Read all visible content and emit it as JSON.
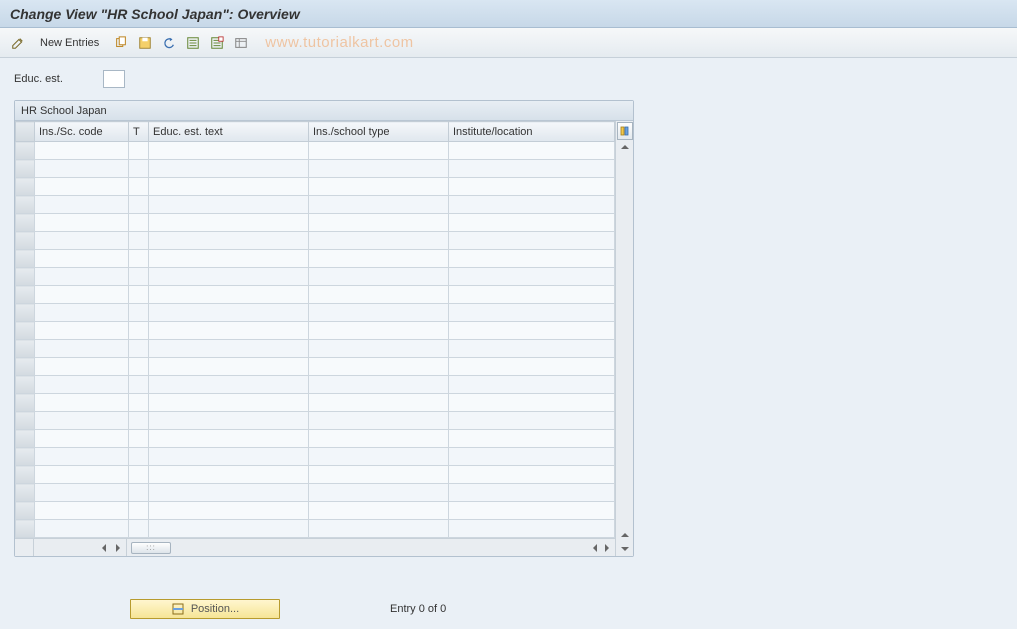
{
  "title": "Change View \"HR School Japan\": Overview",
  "toolbar": {
    "new_entries_label": "New Entries"
  },
  "watermark": "www.tutorialkart.com",
  "field": {
    "label": "Educ. est.",
    "value": ""
  },
  "table": {
    "group_title": "HR School Japan",
    "columns": [
      "Ins./Sc. code",
      "T",
      "Educ. est. text",
      "Ins./school type",
      "Institute/location"
    ],
    "rows": 22
  },
  "footer": {
    "position_label": "Position...",
    "entry_text": "Entry 0 of 0"
  }
}
